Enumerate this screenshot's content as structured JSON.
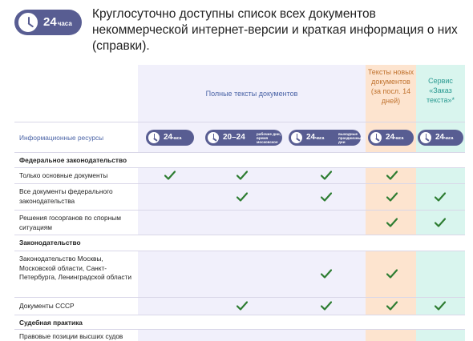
{
  "intro": {
    "badge_number": "24",
    "badge_unit": "часа",
    "text": "Круглосуточно доступны список всех документов некоммерческой интернет-версии и краткая информация о них (справки)."
  },
  "header": {
    "main": "Полные тексты документов",
    "orange": "Тексты новых документов (за посл. 14 дней)",
    "green": "Сервис «Заказ текста»*"
  },
  "resources_row": {
    "label": "Информационные ресурсы",
    "badges": [
      {
        "number": "24",
        "unit": "часа",
        "note": ""
      },
      {
        "number": "20–24",
        "unit": "",
        "note": "рабочие дни, время московское"
      },
      {
        "number": "24",
        "unit": "часа",
        "note": "выходные праздничные дни"
      },
      {
        "number": "24",
        "unit": "часа",
        "note": ""
      },
      {
        "number": "24",
        "unit": "часа",
        "note": ""
      }
    ]
  },
  "sections": [
    {
      "title": "Федеральное законодательство"
    },
    {
      "title": "Законодательство"
    },
    {
      "title": "Судебная практика"
    }
  ],
  "rows": [
    {
      "label": "Только основные документы",
      "checks": [
        true,
        true,
        true,
        true,
        false
      ]
    },
    {
      "label": "Все документы федерального законодательства",
      "checks": [
        false,
        true,
        true,
        true,
        true
      ]
    },
    {
      "label": "Решения госорганов по спорным ситуациям",
      "checks": [
        false,
        false,
        false,
        true,
        true
      ]
    },
    {
      "label": "Законодательство Москвы, Московской области, Санкт-Петербурга, Ленинградской области",
      "checks": [
        false,
        false,
        true,
        true,
        false
      ]
    },
    {
      "label": "Документы СССР",
      "checks": [
        false,
        true,
        true,
        true,
        true
      ]
    },
    {
      "label": "Правовые позиции высших судов",
      "checks": [
        false,
        false,
        false,
        false,
        false
      ]
    }
  ],
  "colors": {
    "accent": "#585d92",
    "check": "#2e7d32",
    "main_bg": "#f1f0fb",
    "orange_bg": "#fde4cf",
    "green_bg": "#d9f5ee"
  }
}
